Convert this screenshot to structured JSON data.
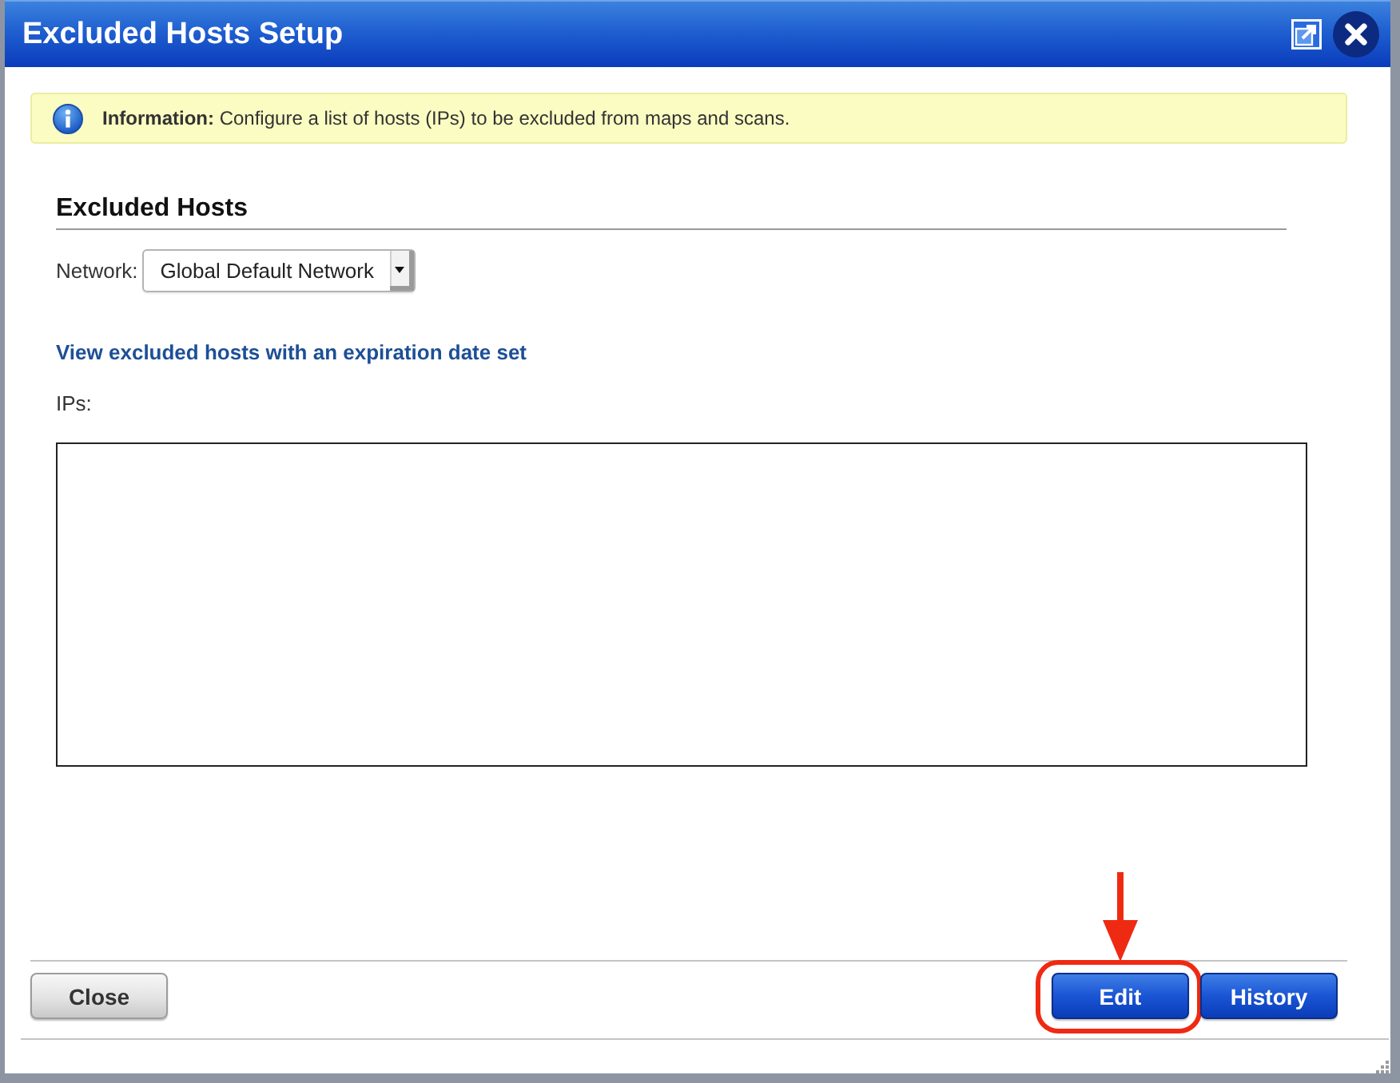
{
  "window": {
    "title": "Excluded Hosts Setup"
  },
  "info": {
    "text": "**Information:** Configure a list of hosts (IPs) to be excluded from maps and scans."
  },
  "section": {
    "heading": "Excluded Hosts"
  },
  "network": {
    "label": "Network:",
    "value": "Global Default Network"
  },
  "link": "View excluded hosts with an expiration date set",
  "ips": {
    "label": "IPs:"
  },
  "buttons": [
    {
      "label": "Close",
      "kind": "secondary",
      "highlighted": false
    },
    {
      "label": "Edit",
      "kind": "primary",
      "highlighted": true
    },
    {
      "label": "History",
      "kind": "primary",
      "highlighted": false
    }
  ]
}
